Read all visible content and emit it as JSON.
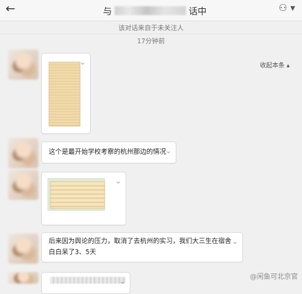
{
  "header": {
    "back_icon": "arrow-left-icon",
    "title_prefix": "与",
    "title_suffix": "话中",
    "user_icon": "user-menu-icon"
  },
  "notice": "该对话来自于未关注人",
  "timestamp": "17分钟前",
  "collapse_label": "收起本条",
  "messages": [
    {
      "type": "image",
      "sender_avatar": "avatar"
    },
    {
      "type": "text",
      "text": "这个是最开始学校考察的杭州那边的情况"
    },
    {
      "type": "image",
      "sender_avatar": "avatar"
    },
    {
      "type": "text",
      "text": "后来因为舆论的压力，取消了去杭州的实习，我们大三生在宿舍白白呆了3、5天"
    },
    {
      "type": "image",
      "sender_avatar": "avatar"
    }
  ],
  "watermark": "@闲鱼可北京官"
}
